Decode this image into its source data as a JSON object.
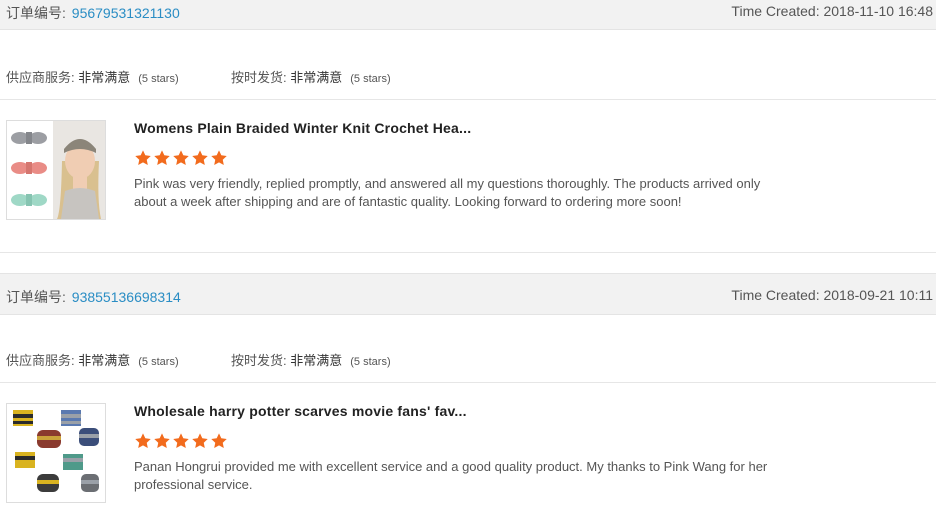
{
  "orders": [
    {
      "order_label": "订单编号:",
      "order_number": "95679531321130",
      "time_created": "Time Created: 2018-11-10 16:48",
      "supplier_service_label": "供应商服务:",
      "supplier_service_value": "非常满意",
      "supplier_service_stars": "(5 stars)",
      "shipping_label": "按时发货:",
      "shipping_value": "非常满意",
      "shipping_stars": "(5 stars)",
      "product_title": "Womens Plain Braided Winter Knit Crochet Hea...",
      "rating": 5,
      "review": "Pink was very friendly, replied promptly, and answered all my questions thoroughly. The products arrived only about a week after shipping and are of fantastic quality. Looking forward to ordering more soon!"
    },
    {
      "order_label": "订单编号:",
      "order_number": "93855136698314",
      "time_created": "Time Created: 2018-09-21 10:11",
      "supplier_service_label": "供应商服务:",
      "supplier_service_value": "非常满意",
      "supplier_service_stars": "(5 stars)",
      "shipping_label": "按时发货:",
      "shipping_value": "非常满意",
      "shipping_stars": "(5 stars)",
      "product_title": "Wholesale harry potter scarves movie fans' fav...",
      "rating": 5,
      "review": "Panan Hongrui provided me with excellent service and a good quality product.  My thanks to Pink Wang for her professional service."
    }
  ],
  "colors": {
    "star": "#f26b1d",
    "order_number": "#2a8dc4",
    "header_bg": "#f2f2f2"
  },
  "icons": {
    "rating": "star-icon"
  }
}
